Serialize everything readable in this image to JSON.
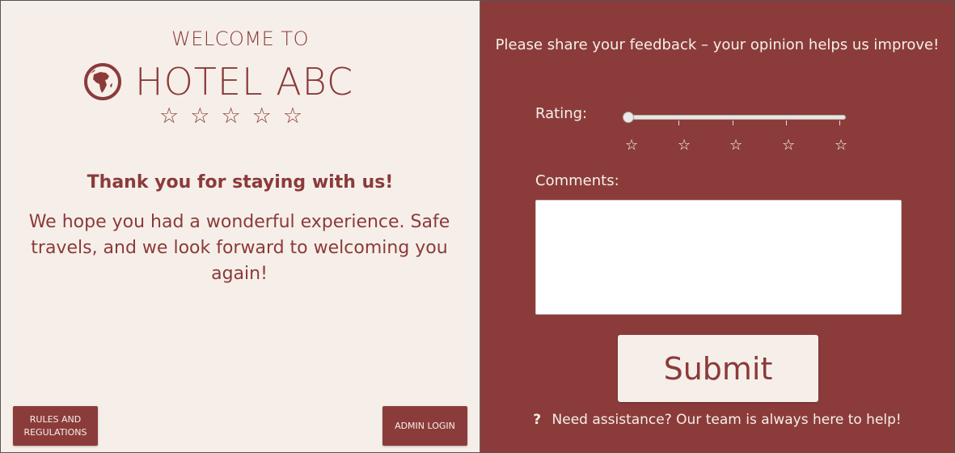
{
  "left": {
    "welcome": "WELCOME TO",
    "hotel_name": "HOTEL ABC",
    "star_count": 5,
    "thanks": "Thank you for staying with us!",
    "message": "We hope you had a wonderful experience. Safe travels, and we look forward to welcoming you again!",
    "rules_button": "RULES AND REGULATIONS",
    "admin_button": "ADMIN LOGIN"
  },
  "right": {
    "prompt": "Please share your feedback – your opinion helps us improve!",
    "rating_label": "Rating:",
    "rating_value": 1,
    "rating_min": 1,
    "rating_max": 5,
    "comments_label": "Comments:",
    "comments_value": "",
    "submit_label": "Submit",
    "assist_text": "Need assistance? Our team is always here to help!",
    "assist_icon": "?"
  },
  "colors": {
    "brand": "#8b3c3a",
    "cream": "#f6efe9"
  }
}
